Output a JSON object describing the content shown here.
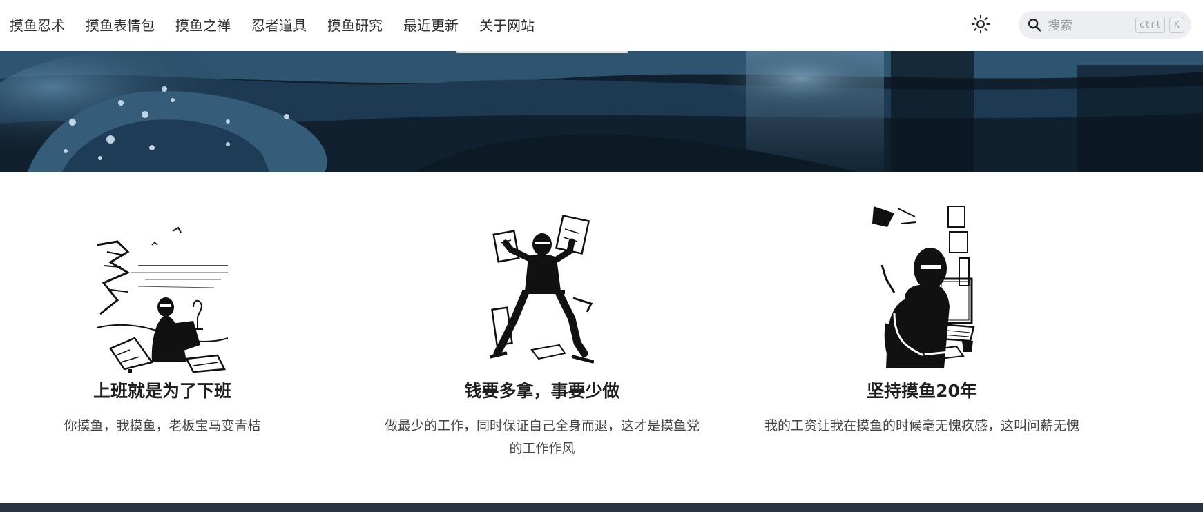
{
  "nav": {
    "items": [
      {
        "label": "摸鱼忍术"
      },
      {
        "label": "摸鱼表情包"
      },
      {
        "label": "摸鱼之禅"
      },
      {
        "label": "忍者道具"
      },
      {
        "label": "摸鱼研究"
      },
      {
        "label": "最近更新"
      },
      {
        "label": "关于网站"
      }
    ]
  },
  "header": {
    "theme_icon": "sun-icon",
    "search": {
      "placeholder": "搜索",
      "shortcut_keys": [
        "ctrl",
        "K"
      ],
      "icon": "search-icon"
    }
  },
  "features": [
    {
      "title": "上班就是为了下班",
      "description": "你摸鱼，我摸鱼，老板宝马变青桔",
      "illustration": "ninja-on-beach-illustration"
    },
    {
      "title": "钱要多拿，事要少做",
      "description": "做最少的工作，同时保证自己全身而退，这才是摸鱼党的工作作风",
      "illustration": "ninja-with-money-illustration"
    },
    {
      "title": "坚持摸鱼20年",
      "description": "我的工资让我在摸鱼的时候毫无愧疚感，这叫问薪无愧",
      "illustration": "ninja-at-computer-illustration"
    }
  ],
  "colors": {
    "footer": "#2b3442",
    "hero_dark": "#0d1c2a",
    "search_bg": "#eceef1"
  }
}
